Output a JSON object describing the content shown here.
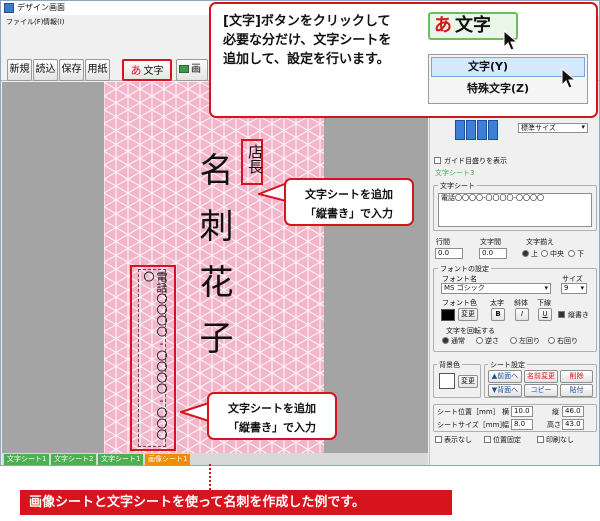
{
  "window": {
    "title": "デザイン画面"
  },
  "menu": [
    "ファイル(F)",
    "情報(I)"
  ],
  "toolbar": {
    "new": "新規",
    "open": "読込",
    "save": "保存",
    "paper": "用紙",
    "text_glyph": "あ",
    "text_label": "文字",
    "image_partial": "画像"
  },
  "card": {
    "name": "名刺花子",
    "title": "店長",
    "phone": "電話〇〇〇〇-〇〇〇〇-〇〇〇〇"
  },
  "sheet_tabs": [
    "文字シート1",
    "文字シート2",
    "文字シート1",
    "画像シート1"
  ],
  "panel": {
    "size_select": "標準サイズ",
    "guide_check": "ガイド目盛りを表示",
    "current_sheet": "文字シート3",
    "text_group": "文字シート",
    "text_value": "電話〇〇〇〇-〇〇〇〇-〇〇〇〇",
    "line_spacing_label": "行間",
    "line_spacing_value": "0.0",
    "char_spacing_label": "文字間",
    "char_spacing_value": "0.0",
    "align_label": "文字揃え",
    "align_options": [
      "上",
      "中央",
      "下"
    ],
    "font_group": "フォントの設定",
    "font_name_label": "フォント名",
    "font_name_value": "MS ゴシック",
    "size_label": "サイズ",
    "size_value": "9",
    "color_label": "フォント色",
    "bold_label": "太字",
    "italic_label": "斜体",
    "underline_label": "下線",
    "change_label": "変更",
    "bold_btn": "B",
    "italic_btn": "I",
    "underline_btn": "U",
    "vertical_label": "縦書き",
    "rotate_label": "文字を回転する",
    "rotate_options": [
      "通常",
      "逆さ",
      "左回り",
      "右回り"
    ],
    "bg_group": "背景色",
    "bg_change": "変更",
    "sheet_group": "シート設定",
    "to_front": "▲前面へ",
    "rename": "名前変更",
    "delete": "削除",
    "to_back": "▼背面へ",
    "copy": "コピー",
    "paste": "貼付",
    "pos_label": "シート位置［mm］",
    "size_mm_label": "シートサイズ［mm］",
    "x_label": "横",
    "x_value": "10.0",
    "y_label": "縦",
    "y_value": "46.0",
    "w_label": "幅",
    "w_value": "8.0",
    "h_label": "高さ",
    "h_value": "43.0",
    "opt_hide": "表示なし",
    "opt_lock": "位置固定",
    "opt_noprint": "印刷なし"
  },
  "popup": {
    "callout_line1": "[文字]ボタンをクリックして",
    "callout_line2": "必要な分だけ、文字シートを",
    "callout_line3": "追加して、設定を行います。",
    "button_glyph": "あ",
    "button_label": "文字",
    "menu_items": [
      "文字(Y)",
      "特殊文字(Z)"
    ]
  },
  "annotations": {
    "upper_line1": "文字シートを追加",
    "upper_line2": "「縦書き」で入力",
    "lower_line1": "文字シートを追加",
    "lower_line2": "「縦書き」で入力"
  },
  "caption": "画像シートと文字シートを使って名刺を作成した例です。",
  "colors": {
    "accent_red": "#d7131d",
    "card_pink": "#f2b5c9",
    "tab_green": "#4caf50",
    "tab_orange": "#f08c00",
    "selected_sheet": "#3b7fd6"
  }
}
